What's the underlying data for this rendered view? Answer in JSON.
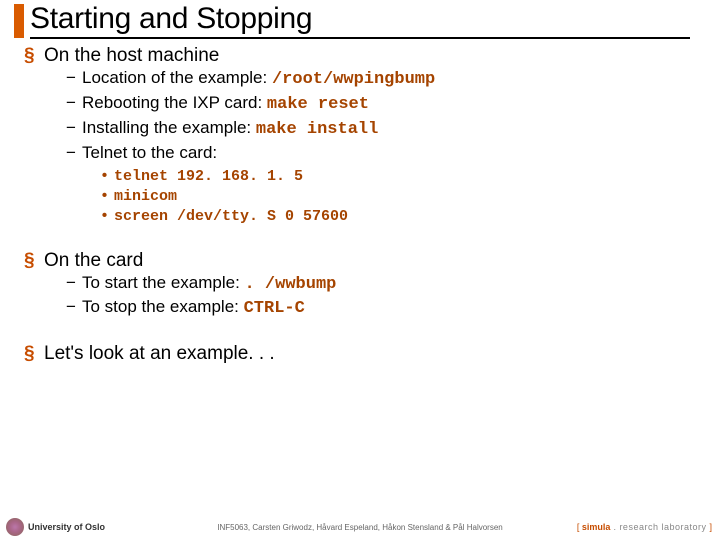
{
  "title": "Starting and Stopping",
  "sections": [
    {
      "heading": "On the host machine",
      "items": [
        {
          "text": "Location of the example: ",
          "code": "/root/wwpingbump"
        },
        {
          "text": "Rebooting the IXP card: ",
          "code": "make reset"
        },
        {
          "text": "Installing the example: ",
          "code": "make install"
        },
        {
          "text": "Telnet to the card:",
          "code": "",
          "sub": [
            "telnet 192. 168. 1. 5",
            "minicom",
            "screen /dev/tty. S 0 57600"
          ]
        }
      ]
    },
    {
      "heading": "On the card",
      "items": [
        {
          "text": "To start the example: ",
          "code": ". /wwbump"
        },
        {
          "text": "To stop the example: ",
          "code": "CTRL-C"
        }
      ]
    },
    {
      "heading": "Let's look at an example. . .",
      "items": []
    }
  ],
  "footer": {
    "university": "University of Oslo",
    "course": "INF5063, Carsten Griwodz, Håvard Espeland, Håkon Stensland & Pål Halvorsen",
    "simula_bracket_open": "[ ",
    "simula_name": "simula",
    "simula_rest": " . research laboratory ",
    "simula_bracket_close": "]"
  }
}
